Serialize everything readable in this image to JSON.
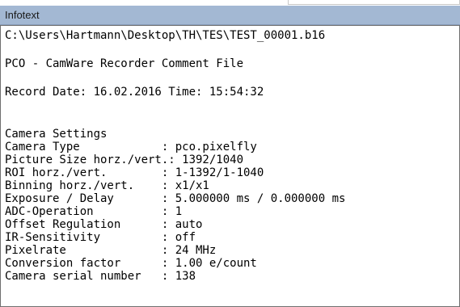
{
  "window": {
    "title": "Infotext"
  },
  "content": {
    "file_path": "C:\\Users\\Hartmann\\Desktop\\TH\\TES\\TEST_00001.b16",
    "header_line": "PCO - CamWare Recorder Comment File",
    "record_line": "Record Date: 16.02.2016 Time: 15:54:32",
    "camera_settings_heading": "Camera Settings",
    "settings": [
      "Camera Type            : pco.pixelfly",
      "Picture Size horz./vert.: 1392/1040",
      "ROI horz./vert.        : 1-1392/1-1040",
      "Binning horz./vert.    : x1/x1",
      "Exposure / Delay       : 5.000000 ms / 0.000000 ms",
      "ADC-Operation          : 1",
      "Offset Regulation      : auto",
      "IR-Sensitivity         : off",
      "Pixelrate              : 24 MHz",
      "Conversion factor      : 1.00 e/count",
      "Camera serial number   : 138"
    ]
  }
}
